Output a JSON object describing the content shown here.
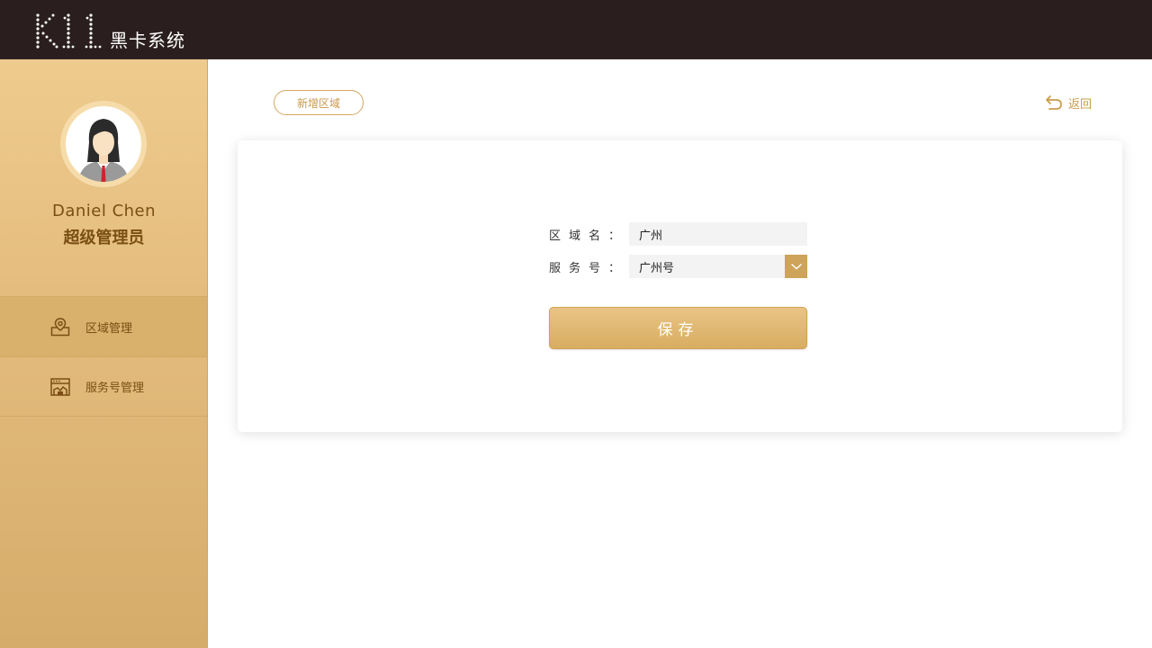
{
  "header": {
    "logo_text": "K11",
    "brand_name": "黑卡系统"
  },
  "sidebar": {
    "user": {
      "name": "Daniel Chen",
      "role": "超级管理员",
      "avatar_icon": "female-avatar"
    },
    "items": [
      {
        "label": "区域管理",
        "icon": "map-pin-icon",
        "active": true
      },
      {
        "label": "服务号管理",
        "icon": "storefront-icon",
        "active": false
      }
    ]
  },
  "toolbar": {
    "add_area_label": "新增区域",
    "back_label": "返回"
  },
  "form": {
    "area_name_label": "区域名",
    "area_name_value": "广州",
    "service_label": "服务号",
    "service_value": "广州号",
    "colon": "：",
    "save_label": "保存"
  },
  "colors": {
    "header_bg": "#2a1f1e",
    "sidebar_gold": "#e3bb7c",
    "accent": "#cda459",
    "text_brown": "#7a4e14"
  }
}
